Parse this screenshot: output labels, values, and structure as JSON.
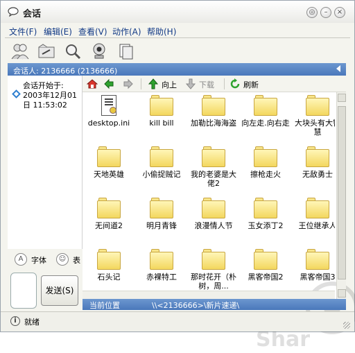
{
  "window": {
    "title": "会话"
  },
  "title_buttons": [
    "pin-icon",
    "minimize-icon",
    "close-icon"
  ],
  "menu": [
    {
      "label": "文件(F)"
    },
    {
      "label": "编辑(E)"
    },
    {
      "label": "查看(V)"
    },
    {
      "label": "动作(A)"
    },
    {
      "label": "帮助(H)"
    }
  ],
  "toolbar": [
    "contacts-icon",
    "share-folder-icon",
    "search-icon",
    "webcam-icon",
    "copy-icon"
  ],
  "contact": {
    "text": "会话人: 2136666 (2136666)"
  },
  "session": {
    "label": "会话开始于:",
    "date": "2003年12月01",
    "time": "日 11:53:02"
  },
  "font_row": {
    "font_label": "字体",
    "emoji_label": "表"
  },
  "send_button": "发送(S)",
  "browser": {
    "toolbar": {
      "back": "back-icon",
      "forward": "forward-icon",
      "up_label": "向上",
      "download_label": "下载",
      "refresh_label": "刷新"
    },
    "files": [
      {
        "name": "desktop.ini",
        "icon": "settings-file-icon"
      },
      {
        "name": "kill bill",
        "icon": "folder-icon"
      },
      {
        "name": "加勒比海海盗",
        "icon": "folder-icon"
      },
      {
        "name": "向左走.向右走",
        "icon": "folder-icon"
      },
      {
        "name": "大块头有大智慧",
        "icon": "folder-icon"
      },
      {
        "name": "天地英雄",
        "icon": "folder-icon"
      },
      {
        "name": "小偷捉贼记",
        "icon": "folder-icon"
      },
      {
        "name": "我的老婆是大佬2",
        "icon": "folder-icon"
      },
      {
        "name": "擦枪走火",
        "icon": "folder-icon"
      },
      {
        "name": "无敌勇士",
        "icon": "folder-icon"
      },
      {
        "name": "无间道2",
        "icon": "folder-icon"
      },
      {
        "name": "明月青锋",
        "icon": "folder-icon"
      },
      {
        "name": "浪漫情人节",
        "icon": "folder-icon"
      },
      {
        "name": "玉女添丁2",
        "icon": "folder-icon"
      },
      {
        "name": "王位继承人",
        "icon": "folder-icon"
      },
      {
        "name": "石头记",
        "icon": "folder-icon"
      },
      {
        "name": "赤裸特工",
        "icon": "folder-icon"
      },
      {
        "name": "那时花开（朴树，周...",
        "icon": "folder-icon"
      },
      {
        "name": "黑客帝国2",
        "icon": "folder-icon"
      },
      {
        "name": "黑客帝国3",
        "icon": "folder-icon"
      }
    ],
    "path_label": "当前位置",
    "path_value": "\\\\<2136666>\\新片速递\\"
  },
  "status": {
    "text": "就绪"
  }
}
